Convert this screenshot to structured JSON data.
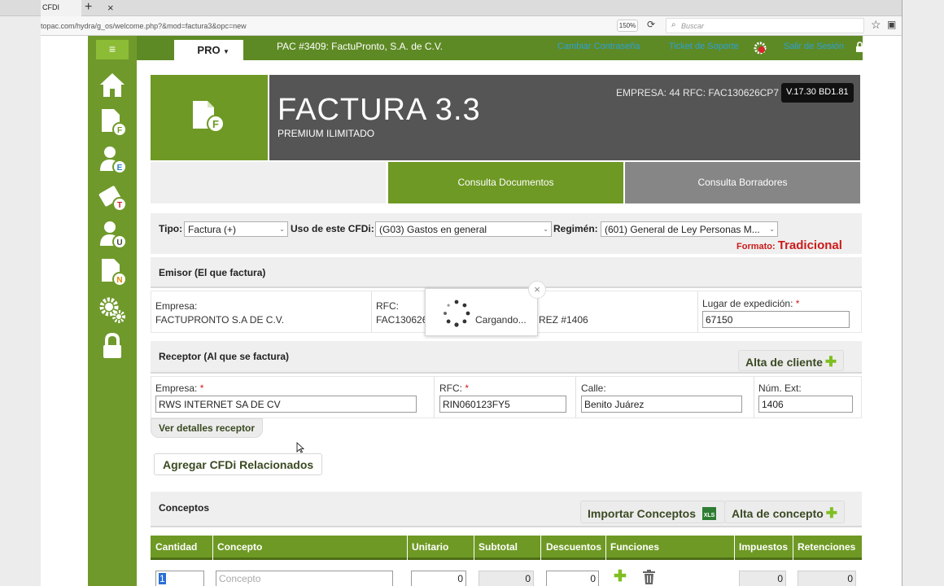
{
  "browser": {
    "tab_title": "CFDI",
    "tab_close": "×",
    "new_tab": "+",
    "url": "topac.com/hydra/g_os/welcome.php?&mod=factura3&opc=new",
    "zoom": "150%",
    "reload": "⟳",
    "search_placeholder": "Buscar",
    "star": "☆",
    "clip": "▣"
  },
  "sidebar": {
    "menu": "≡",
    "items": [
      "home",
      "factura",
      "empleado",
      "ticket",
      "usuario",
      "nomina",
      "configuracion",
      "bloquear"
    ]
  },
  "topbar": {
    "pro_label": "PRO",
    "pac_title": "PAC #3409: FactuPronto, S.A. de C.V.",
    "change_password": "Cambiar Contraseña",
    "support_ticket": "Ticket de Soporte",
    "logout": "Salir de Sesión"
  },
  "header": {
    "title": "FACTURA 3.3",
    "subtitle": "PREMIUM ILIMITADO",
    "empresa_rfc": "EMPRESA: 44 RFC: FAC130626CP7",
    "version": "V.17.30 BD1.81"
  },
  "tabs": {
    "documents": "Consulta Documentos",
    "drafts": "Consulta Borradores"
  },
  "type_row": {
    "tipo_label": "Tipo:",
    "tipo_value": "Factura (+)",
    "uso_label": "Uso de este CFDi:",
    "uso_value": "(G03) Gastos en general",
    "regimen_label": "Regimén:",
    "regimen_value": "(601) General de Ley Personas M...",
    "formato_label": "Formato:",
    "formato_value": "Tradicional"
  },
  "emisor": {
    "title": "Emisor (El que factura)",
    "empresa_label": "Empresa:",
    "empresa_value": "FACTUPRONTO S.A DE C.V.",
    "rfc_label": "RFC:",
    "rfc_value": "FAC130626",
    "address_value": "REZ #1406",
    "lugar_label": "Lugar de expedición:",
    "lugar_value": "67150"
  },
  "loading": {
    "text": "Cargando...",
    "close": "×"
  },
  "receptor": {
    "title": "Receptor (Al que se factura)",
    "alta_cliente": "Alta de cliente",
    "empresa_label": "Empresa:",
    "empresa_value": "RWS INTERNET SA DE CV",
    "rfc_label": "RFC:",
    "rfc_value": "RIN060123FY5",
    "calle_label": "Calle:",
    "calle_value": "Benito Juárez",
    "numext_label": "Núm. Ext:",
    "numext_value": "1406",
    "ver_detalles": "Ver detalles receptor"
  },
  "relacionados": {
    "button": "Agregar CFDi Relacionados"
  },
  "conceptos": {
    "title": "Conceptos",
    "importar": "Importar Conceptos",
    "alta_concepto": "Alta de concepto",
    "columns": [
      "Cantidad",
      "Concepto",
      "Unitario",
      "Subtotal",
      "Descuentos",
      "Funciones",
      "Impuestos",
      "Retenciones"
    ],
    "row": {
      "cantidad": "1",
      "concepto_placeholder": "Concepto",
      "unitario": "0",
      "subtotal": "0",
      "descuentos": "0",
      "impuestos": "0",
      "retenciones": "0"
    }
  },
  "colors": {
    "sidebar": "#6f9a2b",
    "topbar": "#5e8a25",
    "accent_green": "#6e9924",
    "banner_gray": "#555555",
    "link_blue": "#2da0d6",
    "formato_red": "#cc1a1a"
  }
}
